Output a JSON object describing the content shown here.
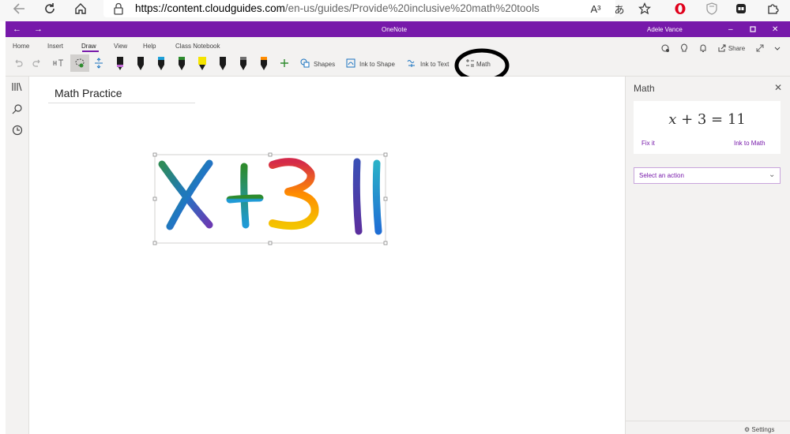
{
  "browser": {
    "url_host": "https://content.cloudguides.com",
    "url_path": "/en-us/guides/Provide%20inclusive%20math%20tools",
    "read_aloud_label": "A³",
    "translate_label": "あ"
  },
  "app": {
    "title": "OneNote",
    "user": "Adele Vance"
  },
  "ribbon": {
    "tabs": [
      "Home",
      "Insert",
      "Draw",
      "View",
      "Help",
      "Class Notebook"
    ],
    "active_tab": "Draw",
    "share_label": "Share",
    "tools": {
      "shapes": "Shapes",
      "ink_to_shape": "Ink to Shape",
      "ink_to_text": "Ink to Text",
      "math": "Math"
    },
    "pen_colors": [
      "#1a1a1a",
      "#1a1a1a",
      "#1fa0d8",
      "#2e8b2e",
      "#f5e400",
      "#1a1a1a",
      "#707070",
      "#ff8c00",
      "#b03030"
    ]
  },
  "page": {
    "title": "Math Practice",
    "handwriting": "X+3=11"
  },
  "math_pane": {
    "title": "Math",
    "equation_var": "x",
    "equation_rest": " + 3 = 11",
    "fix_it": "Fix it",
    "ink_to_math": "Ink to Math",
    "action_placeholder": "Select an action",
    "settings_label": "Settings"
  },
  "colors": {
    "accent": "#7719aa",
    "ribbon_bg": "#f3f2f1"
  }
}
